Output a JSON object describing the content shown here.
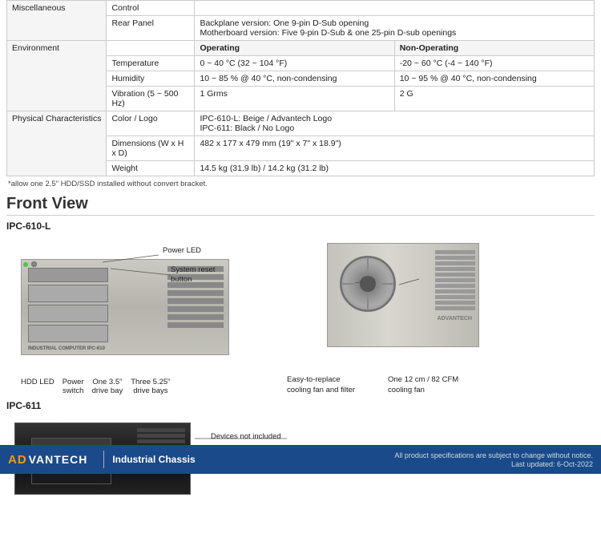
{
  "specs": {
    "sections": [
      {
        "category": "Miscellaneous",
        "rows": [
          {
            "label": "Control",
            "col1": "",
            "col2": ""
          },
          {
            "label": "Rear Panel",
            "col1": "Backplane version: One 9-pin D-Sub opening\nMotherboard version: Five 9-pin D-Sub & one 25-pin D-sub openings",
            "col2": ""
          }
        ]
      },
      {
        "category": "Environment",
        "rows": [
          {
            "label": "",
            "col1": "Operating",
            "col2": "Non-Operating",
            "isHeader": true
          },
          {
            "label": "Temperature",
            "col1": "0 ~ 40 °C (32 ~ 104 °F)",
            "col2": "-20 ~ 60 °C (-4 ~ 140 °F)"
          },
          {
            "label": "Humidity",
            "col1": "10 ~ 85 % @ 40 °C, non-condensing",
            "col2": "10 ~ 95 % @ 40 °C, non-condensing"
          },
          {
            "label": "Vibration (5 ~ 500 Hz)",
            "col1": "1 Grms",
            "col2": "2 G"
          }
        ]
      },
      {
        "category": "Physical Characteristics",
        "rows": [
          {
            "label": "Color / Logo",
            "col1": "IPC-610-L: Beige / Advantech Logo\nIPC-611: Black / No Logo",
            "col2": ""
          },
          {
            "label": "Dimensions (W x H x D)",
            "col1": "482 x 177 x 479 mm (19\" x 7\" x 18.9\")",
            "col2": ""
          },
          {
            "label": "Weight",
            "col1": "14.5 kg (31.9 lb) / 14.2 kg (31.2 lb)",
            "col2": ""
          }
        ]
      }
    ],
    "note": "*allow one 2.5\" HDD/SSD installed without convert bracket."
  },
  "frontView": {
    "title": "Front View",
    "models": {
      "ipc610l": {
        "label": "IPC-610-L",
        "annotations": {
          "powerLED": "Power LED",
          "systemReset": "System reset\nbutton",
          "hddLed": "HDD LED",
          "powerSwitch": "Power\nswitch",
          "driveBay35": "One 3.5\"\ndrive bay",
          "driveBay525": "Three 5.25\"\ndrive bays"
        },
        "rightAnnotations": {
          "coolingFanFilter": "Easy-to-replace\ncooling fan and filter",
          "coolingFan": "One 12 cm / 82 CFM\ncooling fan"
        }
      },
      "ipc611": {
        "label": "IPC-611",
        "annotations": {
          "devicesNotIncluded": "Devices not included"
        }
      }
    }
  },
  "footer": {
    "brand": "AD",
    "brandSuffix": "VANTECH",
    "divider": "|",
    "title": "Industrial Chassis",
    "note": "All product specifications are subject to change without notice.",
    "updated": "Last updated: 6-Oct-2022"
  }
}
